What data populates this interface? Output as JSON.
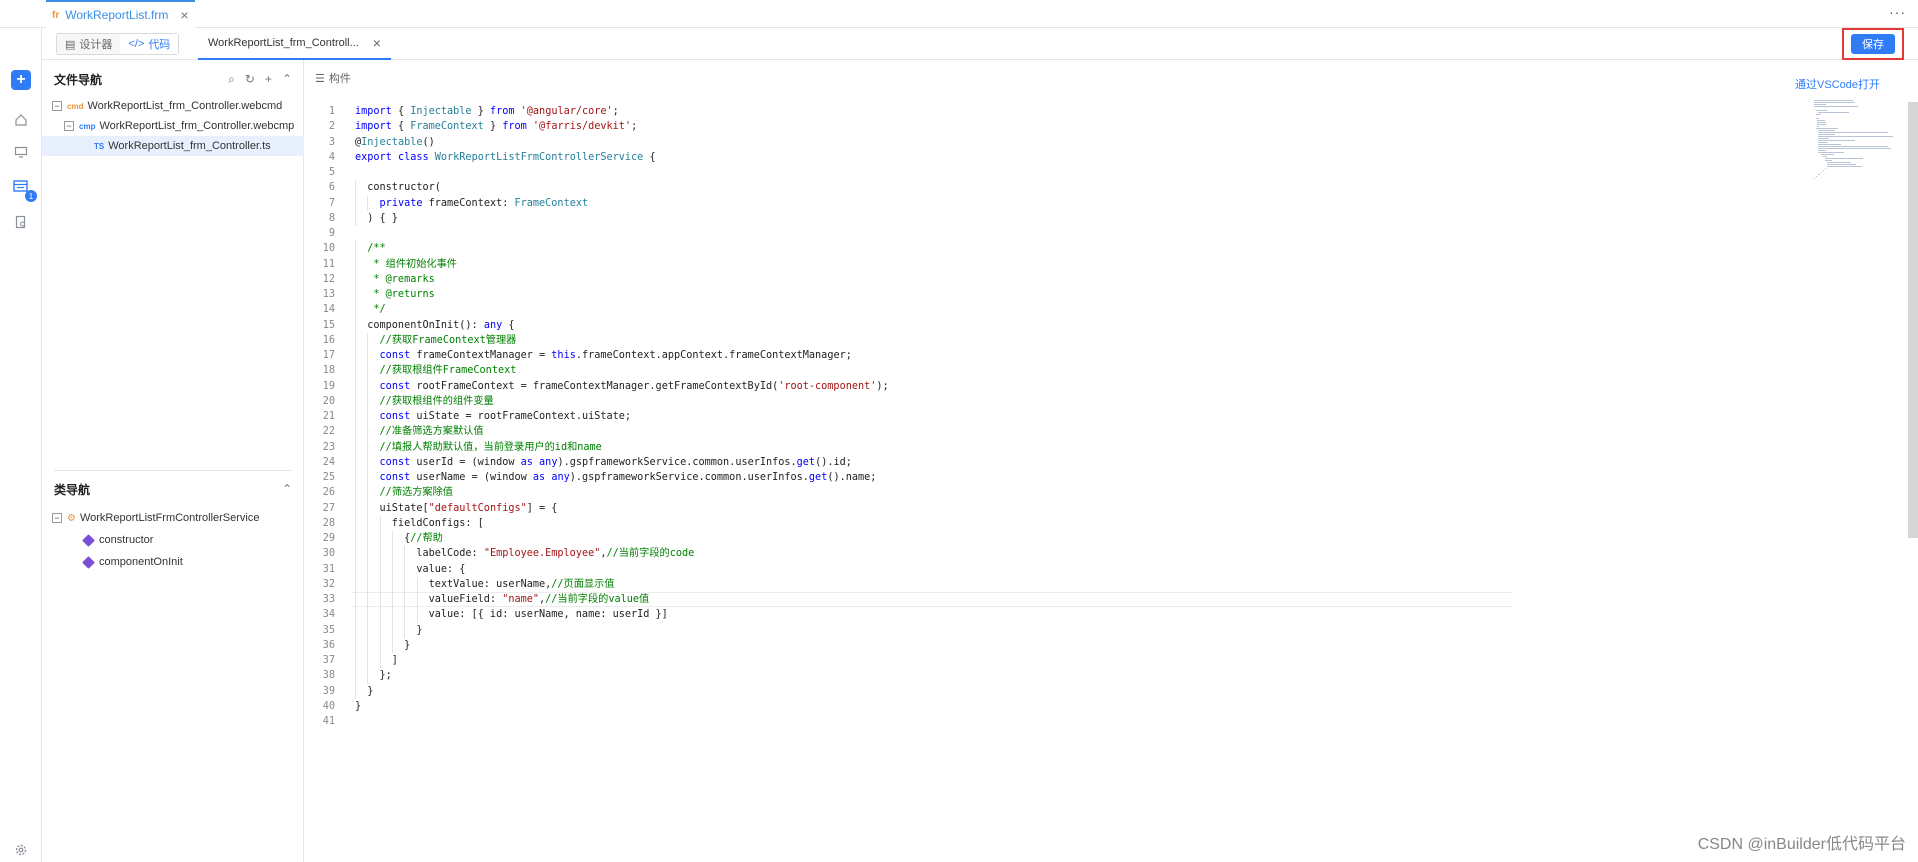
{
  "file_tab": {
    "type_label": "fr",
    "name": "WorkReportList.frm"
  },
  "toolbar": {
    "designer_label": "设计器",
    "code_label": "代码",
    "code_tab_name": "WorkReportList_frm_Controll...",
    "save_label": "保存"
  },
  "activity": {
    "badge_count": "1"
  },
  "file_nav": {
    "title": "文件导航",
    "items": [
      {
        "type": "cmd",
        "name": "WorkReportList_frm_Controller.webcmd"
      },
      {
        "type": "cmp",
        "name": "WorkReportList_frm_Controller.webcmp"
      },
      {
        "type": "TS",
        "name": "WorkReportList_frm_Controller.ts"
      }
    ]
  },
  "class_nav": {
    "title": "类导航",
    "class_name": "WorkReportListFrmControllerService",
    "members": [
      "constructor",
      "componentOnInit"
    ]
  },
  "editor": {
    "component_label": "构件",
    "vscode_label": "通过VSCode打开",
    "current_line": 33
  },
  "watermark": "CSDN @inBuilder低代码平台",
  "colors": {
    "accent": "#2f7cf6",
    "highlight_border": "#e53935"
  },
  "code_lines": [
    "import { Injectable } from '@angular/core';",
    "import { FrameContext } from '@farris/devkit';",
    "@Injectable()",
    "export class WorkReportListFrmControllerService {",
    "",
    "  constructor(",
    "    private frameContext: FrameContext",
    "  ) { }",
    "",
    "  /**",
    "   * 组件初始化事件",
    "   * @remarks",
    "   * @returns",
    "   */",
    "  componentOnInit(): any {",
    "    //获取FrameContext管理器",
    "    const frameContextManager = this.frameContext.appContext.frameContextManager;",
    "    //获取根组件FrameContext",
    "    const rootFrameContext = frameContextManager.getFrameContextById('root-component');",
    "    //获取根组件的组件变量",
    "    const uiState = rootFrameContext.uiState;",
    "    //准备筛选方案默认值",
    "    //填报人帮助默认值，当前登录用户的id和name",
    "    const userId = (window as any).gspframeworkService.common.userInfos.get().id;",
    "    const userName = (window as any).gspframeworkService.common.userInfos.get().name;",
    "    //筛选方案除值",
    "    uiState[\"defaultConfigs\"] = {",
    "      fieldConfigs: [",
    "        {//帮助",
    "          labelCode: \"Employee.Employee\",//当前字段的code",
    "          value: {",
    "            textValue: userName,//页面显示值",
    "            valueField: \"name\",//当前字段的value值",
    "            value: [{ id: userName, name: userId }]",
    "          }",
    "        }",
    "      ]",
    "    };",
    "  }",
    "}",
    ""
  ]
}
